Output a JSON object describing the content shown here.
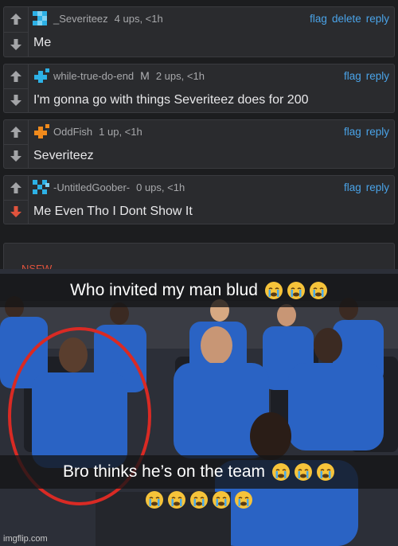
{
  "comments": [
    {
      "username": "_Severiteez",
      "meta": "4 ups, <1h",
      "actions": [
        "flag",
        "delete",
        "reply"
      ],
      "text": "Me",
      "upvoted": false,
      "downvoted": false,
      "avatar_color": "#2db1e6"
    },
    {
      "username": "while-true-do-end",
      "badge": "M",
      "meta": "2 ups, <1h",
      "actions": [
        "flag",
        "reply"
      ],
      "text": "I'm gonna go with things Severiteez does for 200",
      "upvoted": false,
      "downvoted": false,
      "avatar_color": "#2db1e6"
    },
    {
      "username": "OddFish",
      "meta": "1 up, <1h",
      "actions": [
        "flag",
        "reply"
      ],
      "text": "Severiteez",
      "upvoted": false,
      "downvoted": false,
      "avatar_color": "#f08a1c"
    },
    {
      "username": "-UntitledGoober-",
      "meta": "0 ups, <1h",
      "actions": [
        "flag",
        "reply"
      ],
      "text": "Me Even Tho I Dont Show It",
      "upvoted": false,
      "downvoted": true,
      "avatar_color": "#2db1e6"
    }
  ],
  "new_label": "NSFW",
  "meme": {
    "top_caption": "Who invited my man blud",
    "bottom_caption": "Bro thinks he’s on the team",
    "watermark": "imgflip.com"
  },
  "colors": {
    "link": "#4aa3e8",
    "downvote_active": "#e0533d",
    "team_blue": "#2a63c4"
  }
}
